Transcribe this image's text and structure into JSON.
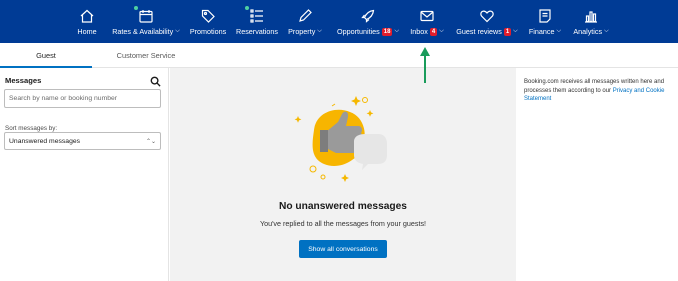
{
  "nav": {
    "home": {
      "label": "Home",
      "icon": "home-icon"
    },
    "rates": {
      "label": "Rates & Availability",
      "icon": "calendar-icon",
      "has_dot": true
    },
    "promotions": {
      "label": "Promotions",
      "icon": "tag-icon"
    },
    "reservations": {
      "label": "Reservations",
      "icon": "list-icon",
      "has_dot": true
    },
    "property": {
      "label": "Property",
      "icon": "pencil-icon"
    },
    "opportunities": {
      "label": "Opportunities",
      "icon": "rocket-icon",
      "badge": "18"
    },
    "inbox": {
      "label": "Inbox",
      "icon": "envelope-icon",
      "badge": "4"
    },
    "guest_reviews": {
      "label": "Guest reviews",
      "icon": "heart-icon",
      "badge": "1"
    },
    "finance": {
      "label": "Finance",
      "icon": "document-icon"
    },
    "analytics": {
      "label": "Analytics",
      "icon": "bar-chart-icon"
    }
  },
  "tabs": {
    "guest": "Guest",
    "customer_service": "Customer Service",
    "active": "guest"
  },
  "left": {
    "title": "Messages",
    "search_placeholder": "Search by name or booking number",
    "sort_label": "Sort messages by:",
    "sort_value": "Unanswered messages"
  },
  "center": {
    "empty_title": "No unanswered messages",
    "empty_subtitle": "You've replied to all the messages from your guests!",
    "show_button": "Show all conversations"
  },
  "right": {
    "note_text": "Booking.com receives all messages written here and processes them according to our ",
    "note_link": "Privacy and Cookie Statement"
  },
  "colors": {
    "nav_bg": "#003b95",
    "accent": "#0071c2",
    "badge": "#e11d2c",
    "notification_dot": "#4fd1a1",
    "annotation_arrow": "#1a9c5b",
    "illustration_yellow": "#f5b800",
    "illustration_gray": "#9a9a9a"
  }
}
